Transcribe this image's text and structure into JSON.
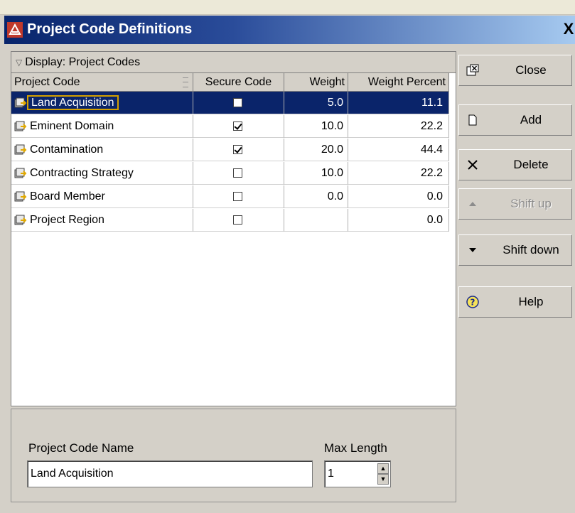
{
  "window": {
    "title": "Project Code Definitions",
    "close_glyph": "X"
  },
  "list": {
    "group_label": "Display: Project Codes",
    "columns": [
      "Project Code",
      "Secure Code",
      "Weight",
      "Weight Percent"
    ],
    "rows": [
      {
        "name": "Land Acquisition",
        "secure": false,
        "weight": "5.0",
        "percent": "11.1",
        "selected": true
      },
      {
        "name": "Eminent Domain",
        "secure": true,
        "weight": "10.0",
        "percent": "22.2",
        "selected": false
      },
      {
        "name": "Contamination",
        "secure": true,
        "weight": "20.0",
        "percent": "44.4",
        "selected": false
      },
      {
        "name": "Contracting Strategy",
        "secure": false,
        "weight": "10.0",
        "percent": "22.2",
        "selected": false
      },
      {
        "name": "Board Member",
        "secure": false,
        "weight": "0.0",
        "percent": "0.0",
        "selected": false
      },
      {
        "name": "Project Region",
        "secure": false,
        "weight": "",
        "percent": "0.0",
        "selected": false
      }
    ]
  },
  "form": {
    "name_label": "Project Code Name",
    "name_value": "Land Acquisition",
    "max_label": "Max Length",
    "max_value": "1"
  },
  "buttons": {
    "close": {
      "label": "Close",
      "icon": "close-window-icon"
    },
    "add": {
      "label": "Add",
      "icon": "new-document-icon"
    },
    "delete": {
      "label": "Delete",
      "icon": "x-delete-icon"
    },
    "shift_up": {
      "label": "Shift up",
      "icon": "triangle-up-icon",
      "disabled": true
    },
    "shift_down": {
      "label": "Shift down",
      "icon": "triangle-down-icon"
    },
    "help": {
      "label": "Help",
      "icon": "question-circle-icon"
    }
  },
  "colors": {
    "title_start": "#08246b",
    "title_end": "#a6caf0",
    "selection": "#0a246a",
    "panel": "#d4d0c8"
  }
}
